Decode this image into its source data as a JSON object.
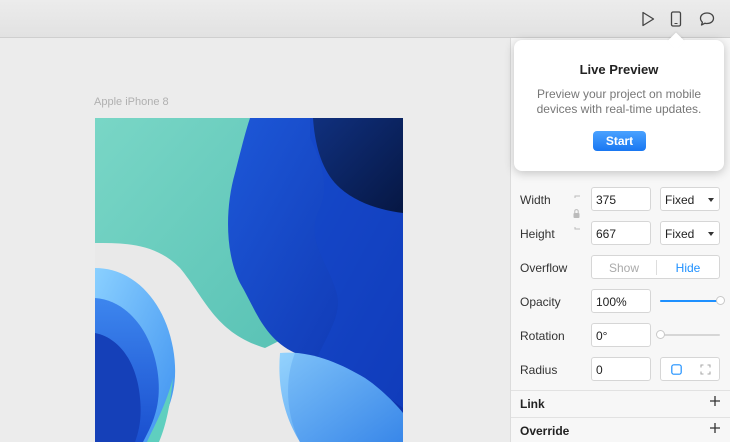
{
  "toolbar": {
    "icons": [
      "play-icon",
      "device-icon",
      "comment-icon"
    ]
  },
  "canvas": {
    "frame_label": "Apple iPhone 8"
  },
  "panel": {
    "width": {
      "label": "Width",
      "value": "375",
      "mode": "Fixed"
    },
    "height": {
      "label": "Height",
      "value": "667",
      "mode": "Fixed"
    },
    "overflow": {
      "label": "Overflow",
      "options": [
        "Show",
        "Hide"
      ],
      "selected": "Hide"
    },
    "opacity": {
      "label": "Opacity",
      "value": "100%",
      "level": 1.0
    },
    "rotation": {
      "label": "Rotation",
      "value": "0°",
      "level": 0.0
    },
    "radius": {
      "label": "Radius",
      "value": "0"
    },
    "sections": {
      "link": "Link",
      "override": "Override"
    }
  },
  "popover": {
    "title": "Live Preview",
    "description": "Preview your project on mobile devices with real-time updates.",
    "button": "Start"
  },
  "colors": {
    "accent": "#1e90ff",
    "button": "#1877f2"
  }
}
